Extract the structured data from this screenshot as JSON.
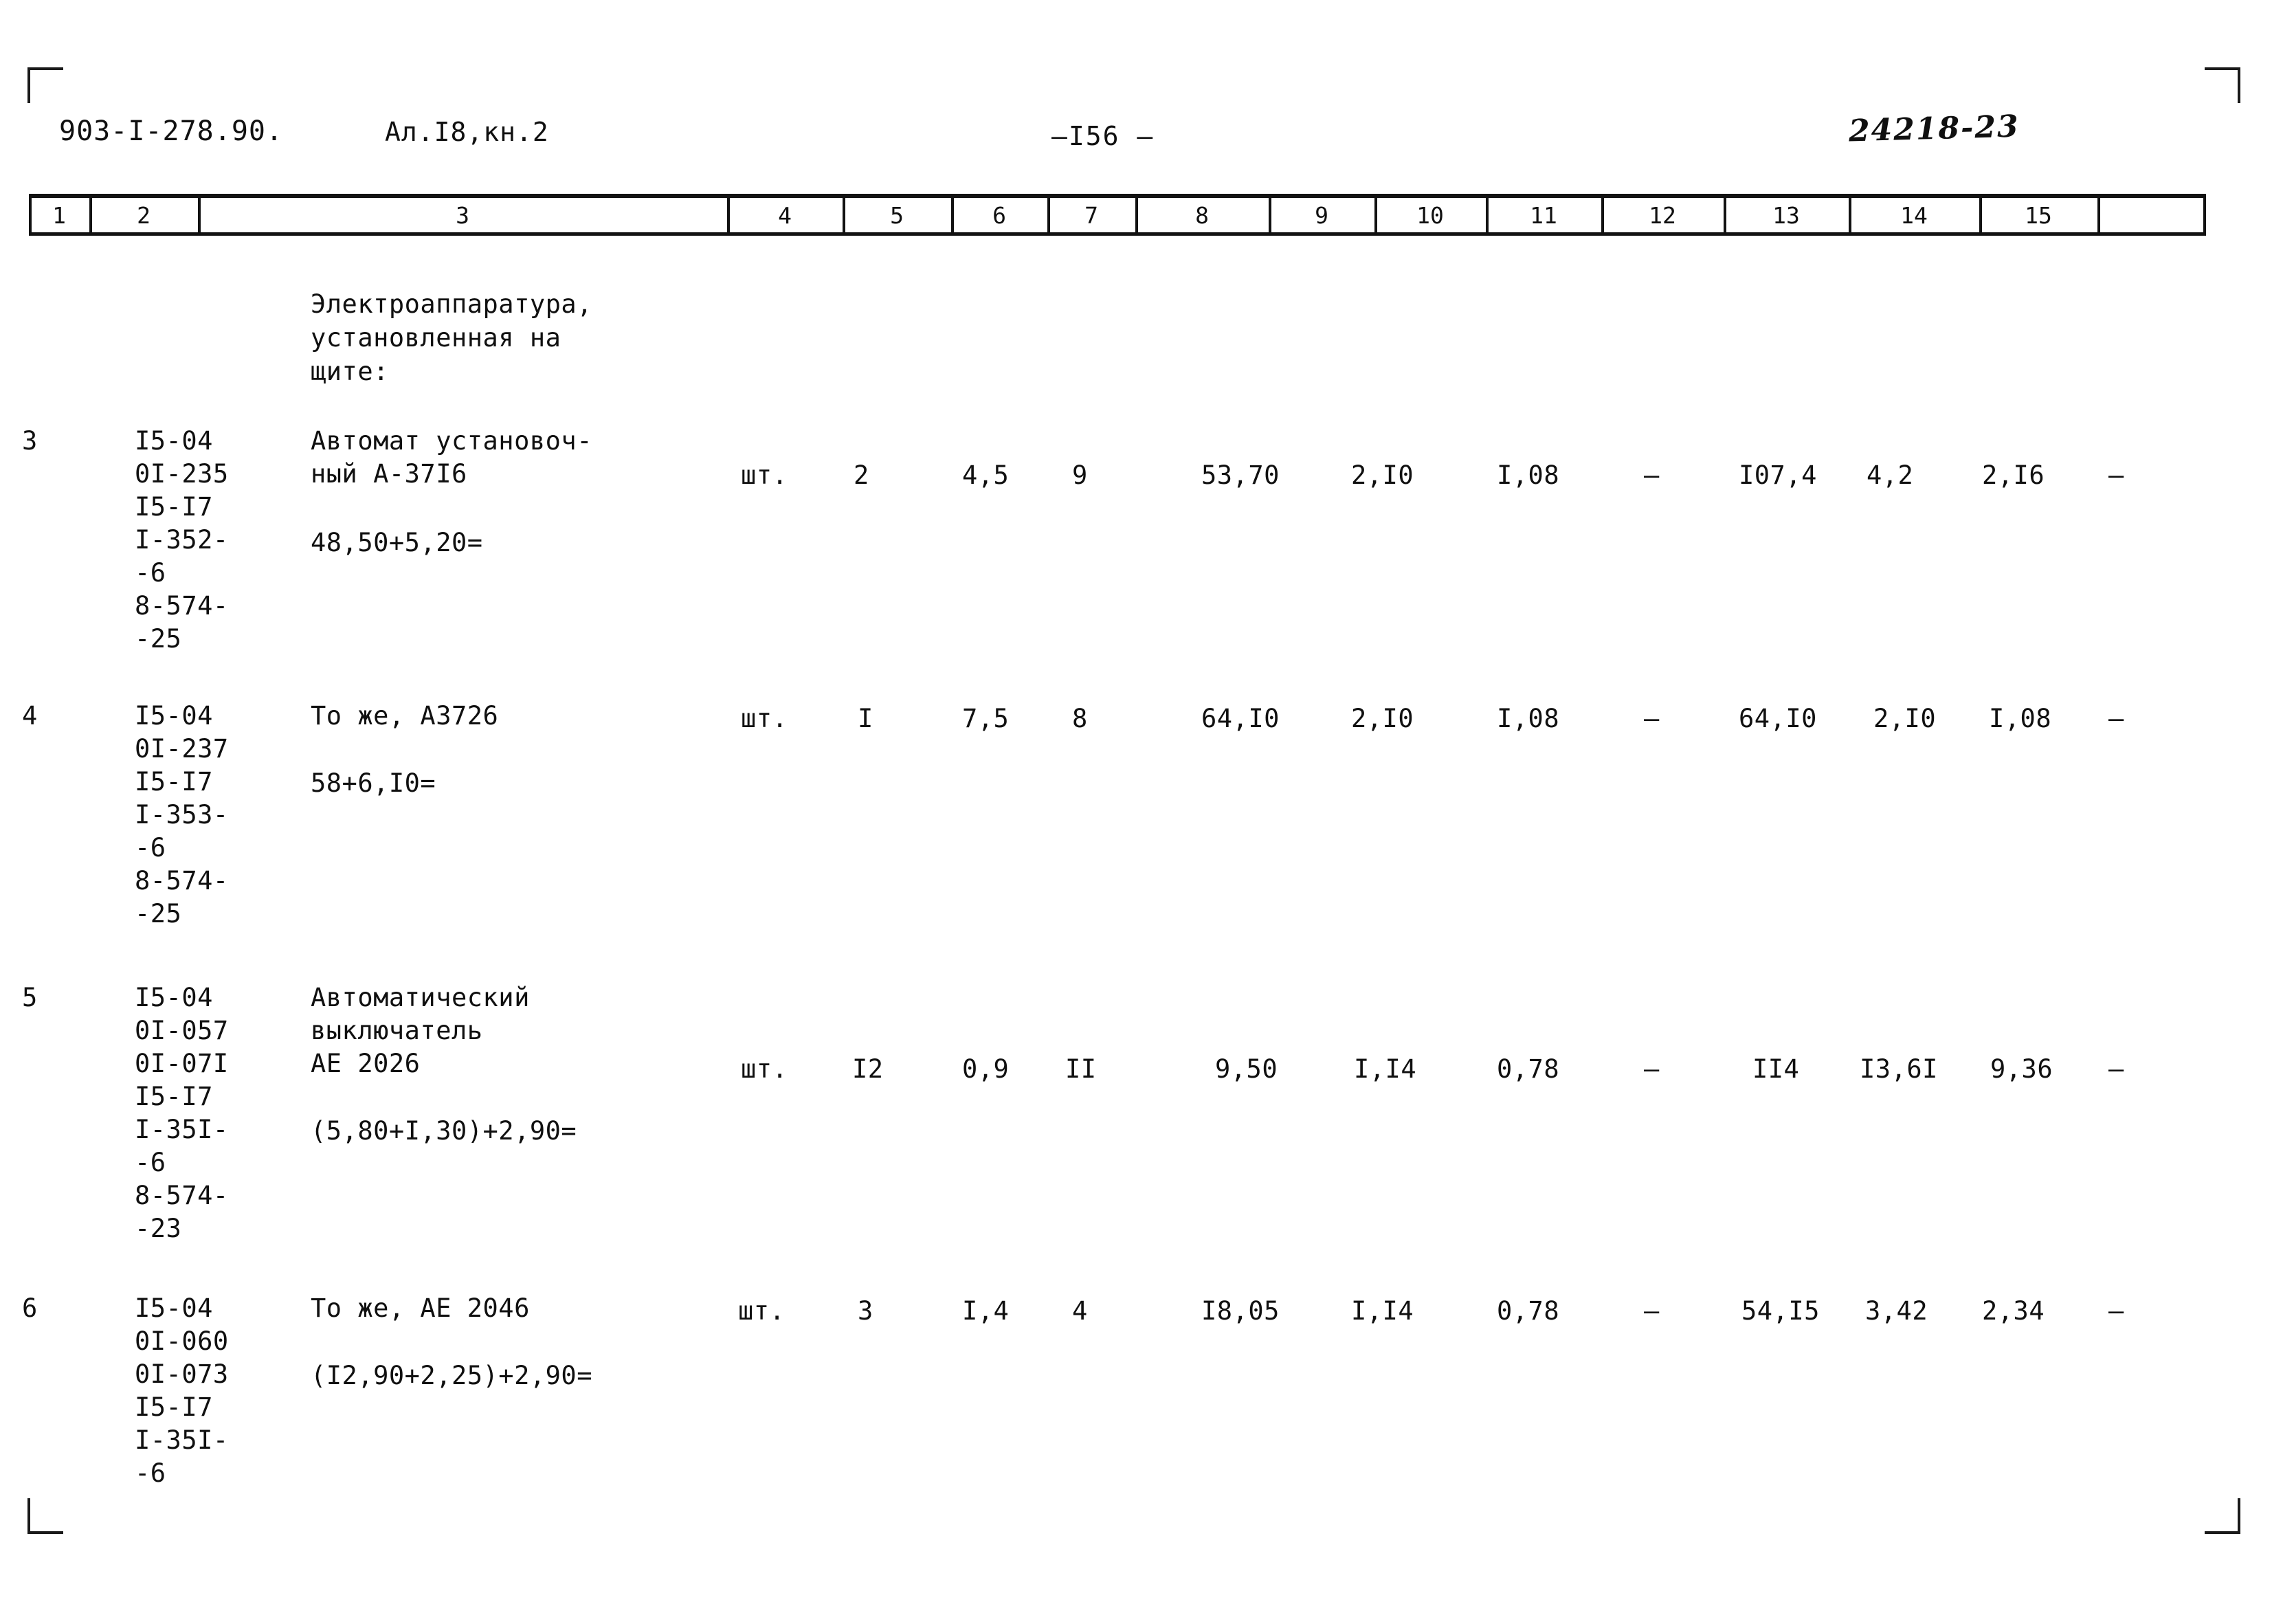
{
  "header": {
    "doc_code": "903-I-278.90.",
    "album_ref": "Ал.I8,кн.2",
    "page_number": "—I56 —",
    "stamp_code": "24218-23"
  },
  "table": {
    "column_headers": [
      "1",
      "2",
      "3",
      "4",
      "5",
      "6",
      "7",
      "8",
      "9",
      "10",
      "11",
      "12",
      "13",
      "14",
      "15"
    ],
    "lead_note": "Электроаппаратура,\nустановленная на\nщите:",
    "rows": [
      {
        "pos": "3",
        "codes": "I5-04\n0I-235\nI5-I7\nI-352-\n-6\n8-574-\n-25",
        "name": "Автомат установоч-\nный А-37I6",
        "formula": "48,50+5,20=",
        "unit": "шт.",
        "qty": "2",
        "c6": "4,5",
        "c7": "9",
        "c8": "53,70",
        "c9": "2,I0",
        "c10": "I,08",
        "c11": "–",
        "c12": "I07,4",
        "c13": "4,2",
        "c14": "2,I6",
        "c15": "–"
      },
      {
        "pos": "4",
        "codes": "I5-04\n0I-237\nI5-I7\nI-353-\n-6\n8-574-\n-25",
        "name": "То же, А3726",
        "formula": "58+6,I0=",
        "unit": "шт.",
        "qty": "I",
        "c6": "7,5",
        "c7": "8",
        "c8": "64,I0",
        "c9": "2,I0",
        "c10": "I,08",
        "c11": "–",
        "c12": "64,I0",
        "c13": "2,I0",
        "c14": "I,08",
        "c15": "–"
      },
      {
        "pos": "5",
        "codes": "I5-04\n0I-057\n0I-07I\nI5-I7\nI-35I-\n-6\n8-574-\n-23",
        "name": "Автоматический\nвыключатель\nАЕ 2026",
        "formula": "(5,80+I,30)+2,90=",
        "unit": "шт.",
        "qty": "I2",
        "c6": "0,9",
        "c7": "II",
        "c8": "9,50",
        "c9": "I,I4",
        "c10": "0,78",
        "c11": "–",
        "c12": "II4",
        "c13": "I3,6I",
        "c14": "9,36",
        "c15": "–"
      },
      {
        "pos": "6",
        "codes": "I5-04\n0I-060\n0I-073\nI5-I7\nI-35I-\n-6",
        "name": "То же, АЕ 2046",
        "formula": "(I2,90+2,25)+2,90=",
        "unit": "шт.",
        "qty": "3",
        "c6": "I,4",
        "c7": "4",
        "c8": "I8,05",
        "c9": "I,I4",
        "c10": "0,78",
        "c11": "–",
        "c12": "54,I5",
        "c13": "3,42",
        "c14": "2,34",
        "c15": "–"
      }
    ]
  }
}
